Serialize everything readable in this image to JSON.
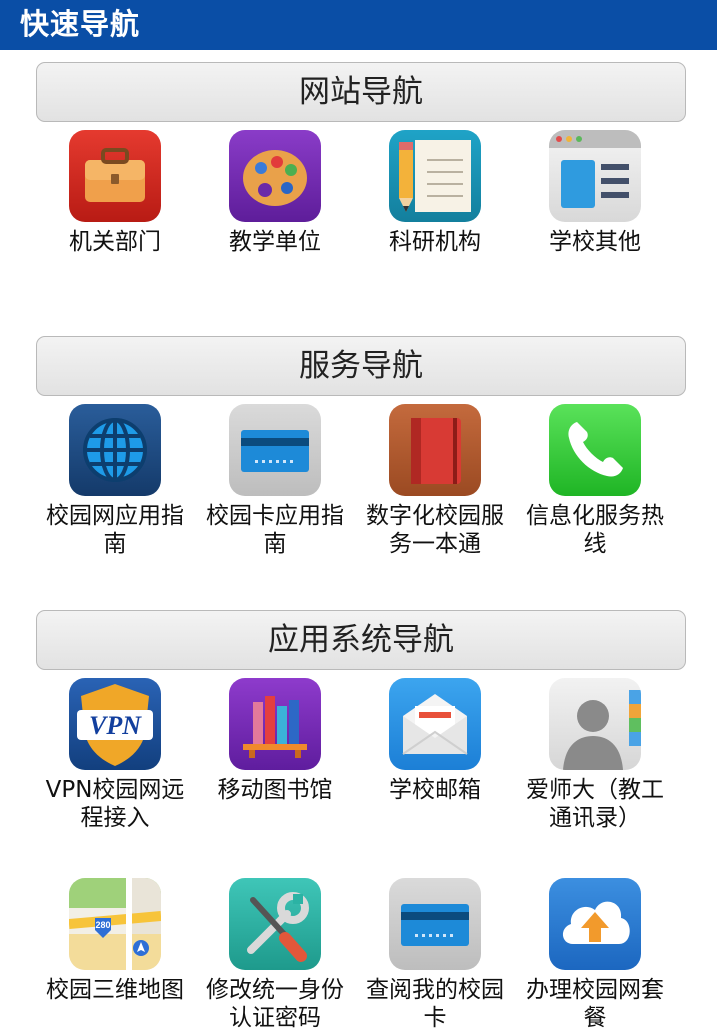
{
  "header": {
    "title": "快速导航"
  },
  "sections": [
    {
      "title": "网站导航",
      "items": [
        {
          "label": "机关部门",
          "icon": "briefcase-icon"
        },
        {
          "label": "教学单位",
          "icon": "palette-icon"
        },
        {
          "label": "科研机构",
          "icon": "notepad-pencil-icon"
        },
        {
          "label": "学校其他",
          "icon": "window-list-icon"
        }
      ]
    },
    {
      "title": "服务导航",
      "items": [
        {
          "label": "校园网应用指南",
          "icon": "globe-icon"
        },
        {
          "label": "校园卡应用指南",
          "icon": "card-icon"
        },
        {
          "label": "数字化校园服务一本通",
          "icon": "book-icon"
        },
        {
          "label": "信息化服务热线",
          "icon": "phone-icon"
        }
      ]
    },
    {
      "title": "应用系统导航",
      "items": [
        {
          "label": "VPN校园网远程接入",
          "icon": "vpn-shield-icon",
          "icon_text": "VPN"
        },
        {
          "label": "移动图书馆",
          "icon": "bookshelf-icon"
        },
        {
          "label": "学校邮箱",
          "icon": "mail-envelope-icon"
        },
        {
          "label": "爱师大（教工通讯录）",
          "icon": "contacts-icon"
        },
        {
          "label": "校园三维地图",
          "icon": "map-icon",
          "icon_text": "280"
        },
        {
          "label": "修改统一身份认证密码",
          "icon": "tools-icon"
        },
        {
          "label": "查阅我的校园卡",
          "icon": "card-icon"
        },
        {
          "label": "办理校园网套餐",
          "icon": "cloud-upload-icon"
        }
      ]
    }
  ]
}
